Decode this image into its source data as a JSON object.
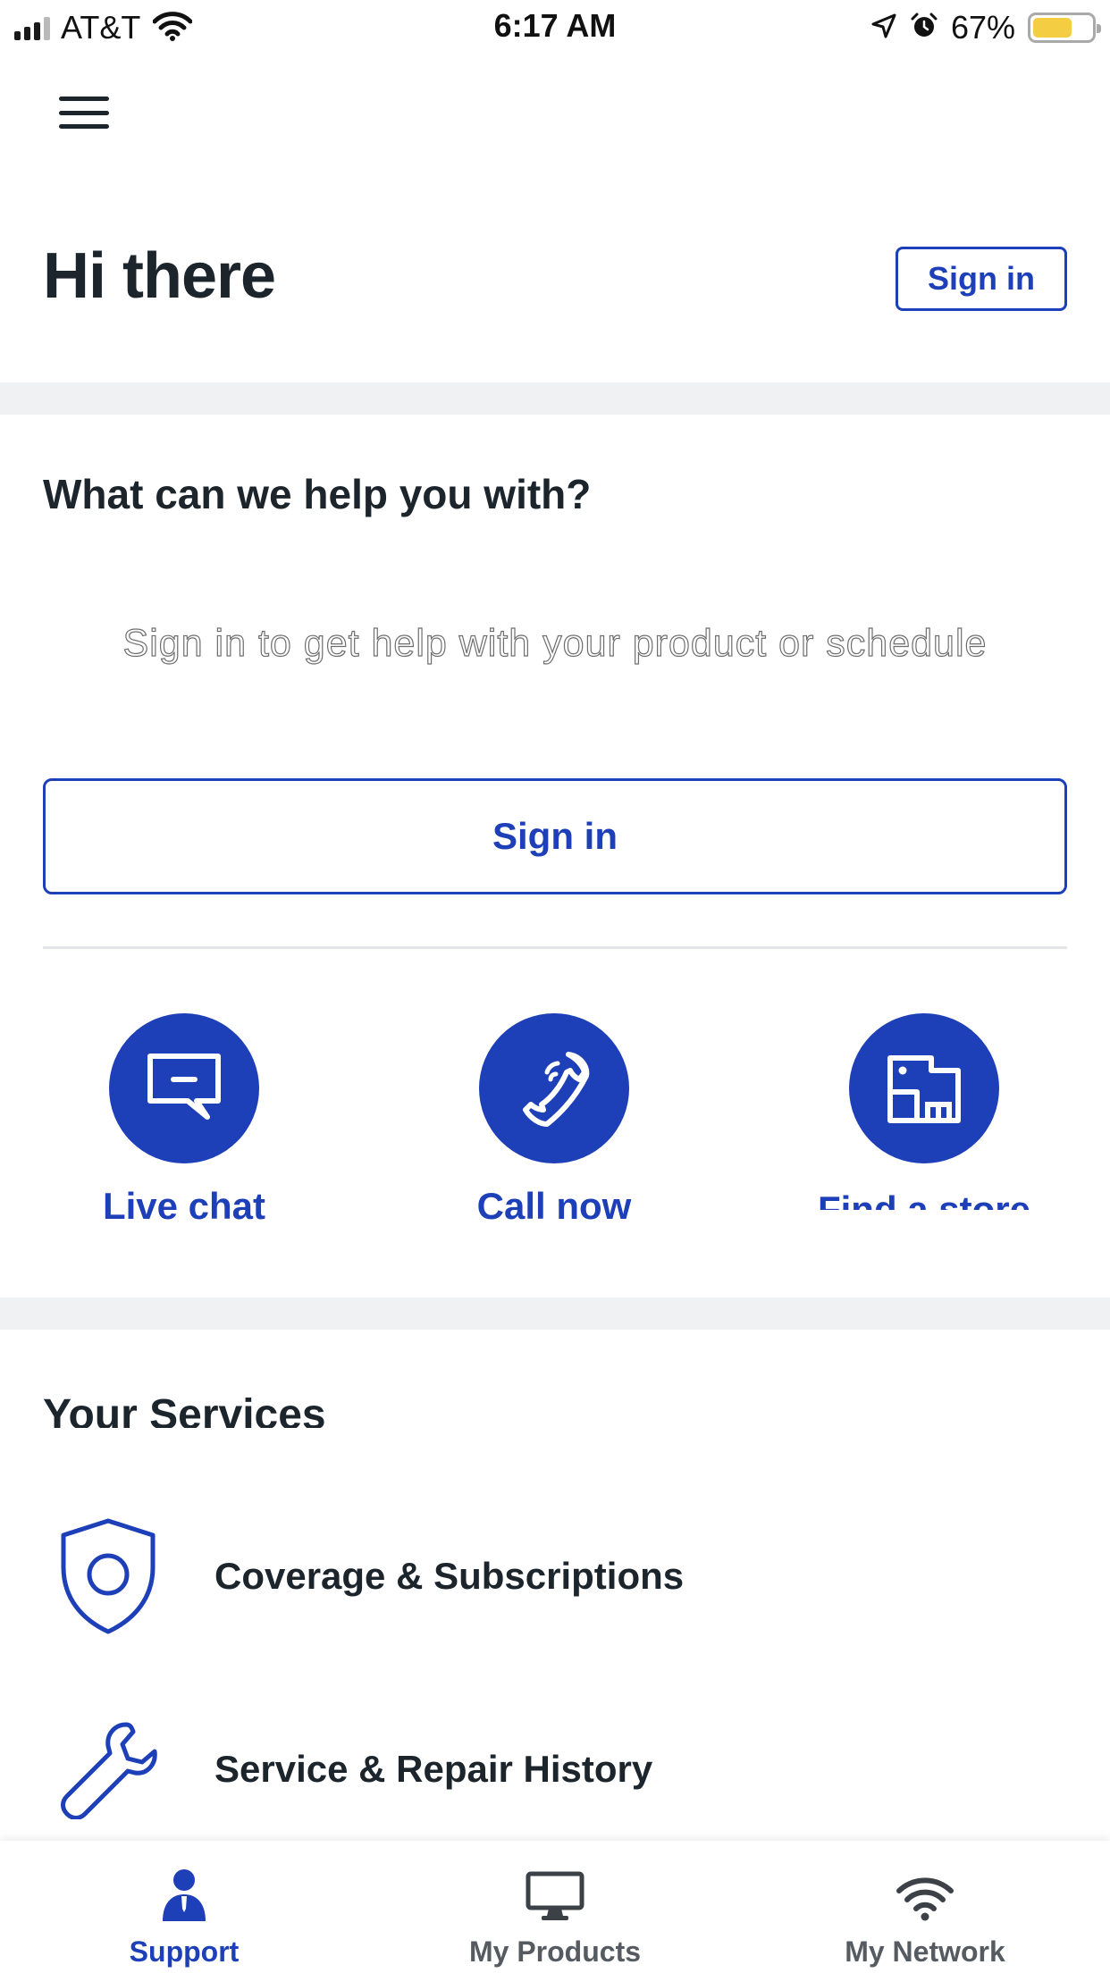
{
  "status_bar": {
    "carrier": "AT&T",
    "time": "6:17 AM",
    "battery_percent": "67%",
    "battery_level": 0.67,
    "battery_color": "#f4cd43",
    "icons": [
      "signal-icon",
      "wifi-icon",
      "location-arrow-icon",
      "alarm-icon",
      "battery-icon"
    ]
  },
  "header": {
    "menu_icon": "hamburger-menu-icon",
    "greeting": "Hi there",
    "sign_in_label": "Sign in"
  },
  "help": {
    "title": "What can we help you with?",
    "description": "Sign in to get help with your product or schedule",
    "sign_in_label": "Sign in"
  },
  "actions": [
    {
      "label": "Live chat",
      "icon": "chat-bubble-icon"
    },
    {
      "label": "Call now",
      "icon": "phone-icon"
    },
    {
      "label": "Find a store",
      "icon": "store-tag-icon"
    }
  ],
  "services": {
    "title": "Your Services",
    "items": [
      {
        "label": "Coverage & Subscriptions",
        "icon": "shield-icon"
      },
      {
        "label": "Service & Repair History",
        "icon": "wrench-icon"
      }
    ]
  },
  "bottom_nav": [
    {
      "label": "Support",
      "icon": "person-icon",
      "active": true
    },
    {
      "label": "My Products",
      "icon": "monitor-icon",
      "active": false
    },
    {
      "label": "My Network",
      "icon": "wifi-icon",
      "active": false
    }
  ],
  "colors": {
    "brand_blue": "#1d3fb8",
    "text_dark": "#1d252c",
    "band_gray": "#f0f1f3"
  }
}
